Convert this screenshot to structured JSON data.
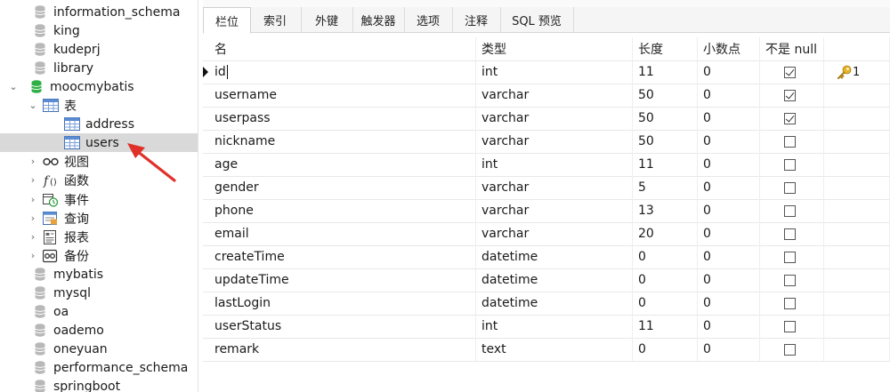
{
  "sidebar": {
    "items": [
      {
        "label": "information_schema",
        "type": "database",
        "level": 0,
        "expanded": false
      },
      {
        "label": "king",
        "type": "database",
        "level": 0,
        "expanded": false
      },
      {
        "label": "kudeprj",
        "type": "database",
        "level": 0,
        "expanded": false
      },
      {
        "label": "library",
        "type": "database",
        "level": 0,
        "expanded": false
      },
      {
        "label": "moocmybatis",
        "type": "database-open",
        "level": 0,
        "expanded": true
      },
      {
        "label": "表",
        "type": "tables-folder",
        "level": 1,
        "expanded": true
      },
      {
        "label": "address",
        "type": "table",
        "level": 2
      },
      {
        "label": "users",
        "type": "table",
        "level": 2,
        "selected": true
      },
      {
        "label": "视图",
        "type": "views-folder",
        "level": 1,
        "expanded": false
      },
      {
        "label": "函数",
        "type": "functions-folder",
        "level": 1,
        "expanded": false
      },
      {
        "label": "事件",
        "type": "events-folder",
        "level": 1,
        "expanded": false
      },
      {
        "label": "查询",
        "type": "queries-folder",
        "level": 1,
        "expanded": false
      },
      {
        "label": "报表",
        "type": "reports-folder",
        "level": 1,
        "expanded": false
      },
      {
        "label": "备份",
        "type": "backups-folder",
        "level": 1,
        "expanded": false
      },
      {
        "label": "mybatis",
        "type": "database",
        "level": 0
      },
      {
        "label": "mysql",
        "type": "database",
        "level": 0
      },
      {
        "label": "oa",
        "type": "database",
        "level": 0
      },
      {
        "label": "oademo",
        "type": "database",
        "level": 0
      },
      {
        "label": "oneyuan",
        "type": "database",
        "level": 0
      },
      {
        "label": "performance_schema",
        "type": "database",
        "level": 0
      },
      {
        "label": "springboot",
        "type": "database",
        "level": 0
      }
    ]
  },
  "tabs": [
    {
      "label": "栏位",
      "active": true
    },
    {
      "label": "索引"
    },
    {
      "label": "外键"
    },
    {
      "label": "触发器"
    },
    {
      "label": "选项"
    },
    {
      "label": "注释"
    },
    {
      "label": "SQL 预览"
    }
  ],
  "grid": {
    "headers": {
      "name": "名",
      "type": "类型",
      "length": "长度",
      "decimals": "小数点",
      "not_null": "不是 null",
      "key": ""
    },
    "rows": [
      {
        "name": "id",
        "type": "int",
        "length": "11",
        "decimals": "0",
        "not_null": true,
        "key": "1",
        "current": true
      },
      {
        "name": "username",
        "type": "varchar",
        "length": "50",
        "decimals": "0",
        "not_null": true
      },
      {
        "name": "userpass",
        "type": "varchar",
        "length": "50",
        "decimals": "0",
        "not_null": true
      },
      {
        "name": "nickname",
        "type": "varchar",
        "length": "50",
        "decimals": "0",
        "not_null": false
      },
      {
        "name": "age",
        "type": "int",
        "length": "11",
        "decimals": "0",
        "not_null": false
      },
      {
        "name": "gender",
        "type": "varchar",
        "length": "5",
        "decimals": "0",
        "not_null": false
      },
      {
        "name": "phone",
        "type": "varchar",
        "length": "13",
        "decimals": "0",
        "not_null": false
      },
      {
        "name": "email",
        "type": "varchar",
        "length": "20",
        "decimals": "0",
        "not_null": false
      },
      {
        "name": "createTime",
        "type": "datetime",
        "length": "0",
        "decimals": "0",
        "not_null": false
      },
      {
        "name": "updateTime",
        "type": "datetime",
        "length": "0",
        "decimals": "0",
        "not_null": false
      },
      {
        "name": "lastLogin",
        "type": "datetime",
        "length": "0",
        "decimals": "0",
        "not_null": false
      },
      {
        "name": "userStatus",
        "type": "int",
        "length": "11",
        "decimals": "0",
        "not_null": false
      },
      {
        "name": "remark",
        "type": "text",
        "length": "0",
        "decimals": "0",
        "not_null": false
      }
    ]
  },
  "colors": {
    "annotation_arrow": "#e0302a",
    "key_icon": "#e8b423",
    "selected_row": "#d9d9d9",
    "db_icon": "#b8b8b8",
    "db_open_icon": "#2fb044"
  }
}
